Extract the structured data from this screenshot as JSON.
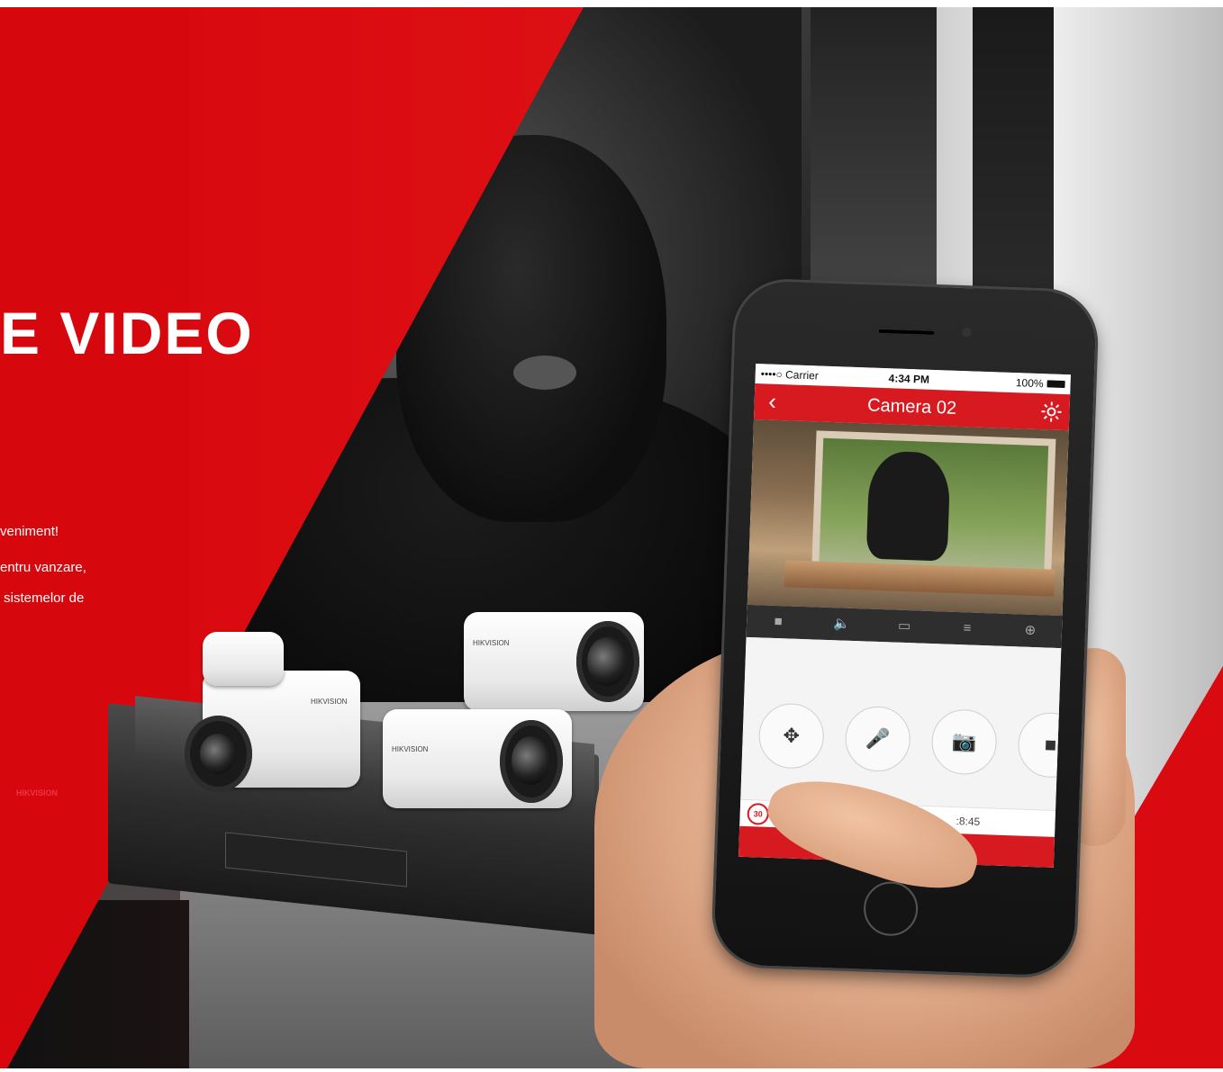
{
  "hero": {
    "headline": "E VIDEO",
    "copy_lines": [
      "veniment!",
      "entru vanzare,",
      " sistemelor de"
    ]
  },
  "brand": {
    "accent_red": "#d7080d",
    "nvr_label": "HIKVISION",
    "camera_label": "HIKVISION"
  },
  "phone": {
    "status_bar": {
      "carrier": "••••○ Carrier",
      "time": "4:34 PM",
      "battery": "100%"
    },
    "app_bar": {
      "title": "Camera 02",
      "back_icon": "chevron-left-icon",
      "settings_icon": "gear-icon"
    },
    "toolbar_icons": [
      "stop-icon",
      "speaker-icon",
      "aspect-ratio-icon",
      "quality-icon",
      "zoom-in-icon"
    ],
    "controls": [
      "ptz-icon",
      "microphone-icon",
      "camera-icon",
      "record-icon"
    ],
    "playback": {
      "icon_label": "30",
      "time": ":8:45"
    }
  }
}
